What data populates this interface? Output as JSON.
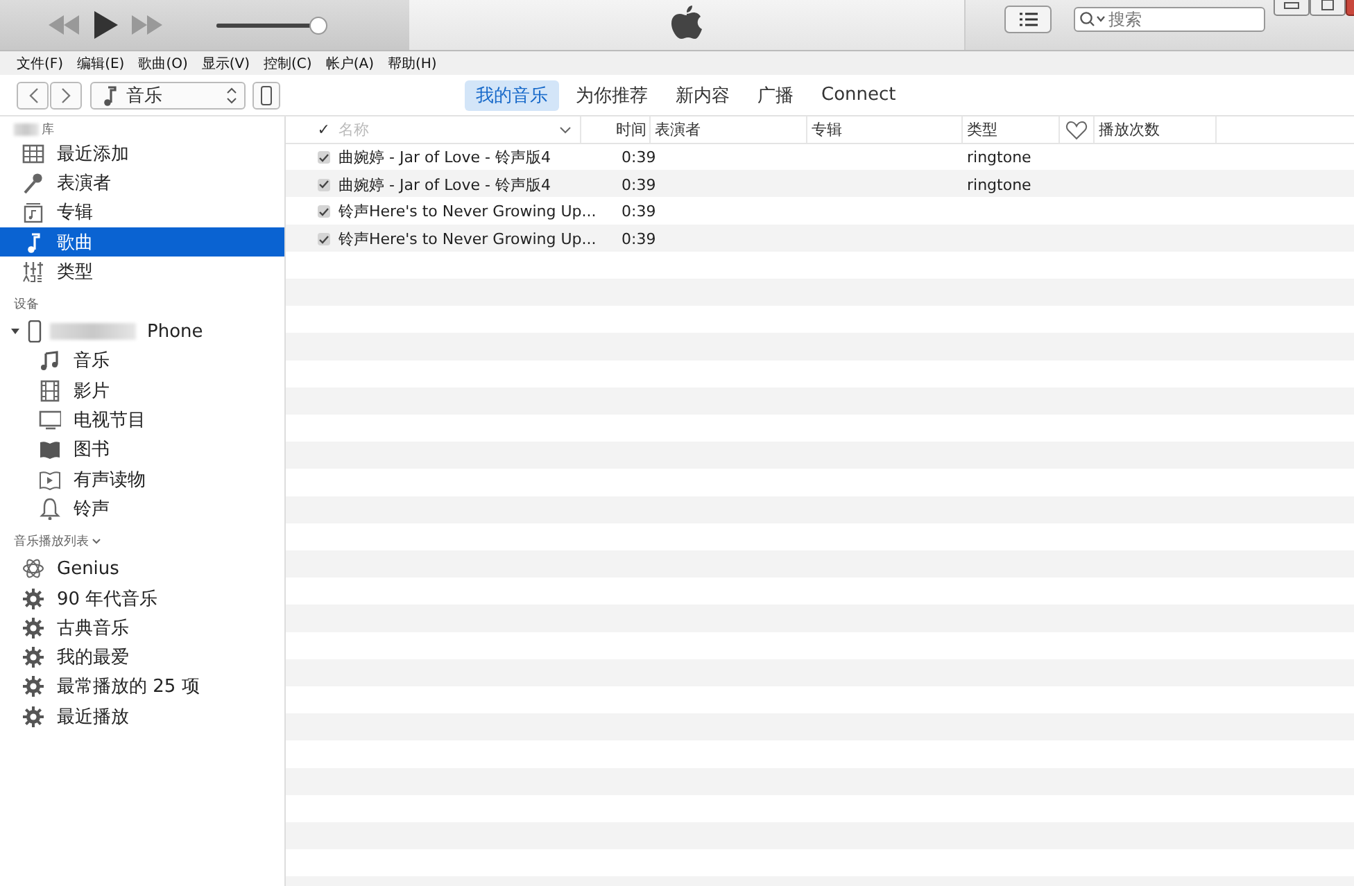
{
  "player": {
    "volume": {
      "level": 0.93
    }
  },
  "search": {
    "placeholder": "搜索"
  },
  "menu": [
    "文件(F)",
    "编辑(E)",
    "歌曲(O)",
    "显示(V)",
    "控制(C)",
    "帐户(A)",
    "帮助(H)"
  ],
  "media_picker": {
    "value": "音乐"
  },
  "tabs": [
    {
      "label": "我的音乐",
      "selected": true
    },
    {
      "label": "为你推荐",
      "selected": false
    },
    {
      "label": "新内容",
      "selected": false
    },
    {
      "label": "广播",
      "selected": false
    },
    {
      "label": "Connect",
      "selected": false
    }
  ],
  "sidebar": {
    "library": {
      "header": "库",
      "items": [
        {
          "label": "最近添加",
          "selected": false
        },
        {
          "label": "表演者",
          "selected": false
        },
        {
          "label": "专辑",
          "selected": false
        },
        {
          "label": "歌曲",
          "selected": true
        },
        {
          "label": "类型",
          "selected": false
        }
      ]
    },
    "devices": {
      "header": "设备",
      "device": {
        "label": "Phone",
        "expanded": true,
        "children": [
          {
            "label": "音乐"
          },
          {
            "label": "影片"
          },
          {
            "label": "电视节目"
          },
          {
            "label": "图书"
          },
          {
            "label": "有声读物"
          },
          {
            "label": "铃声"
          }
        ]
      }
    },
    "playlists": {
      "header": "音乐播放列表",
      "items": [
        {
          "label": "Genius"
        },
        {
          "label": "90 年代音乐"
        },
        {
          "label": "古典音乐"
        },
        {
          "label": "我的最爱"
        },
        {
          "label": "最常播放的 25 项"
        },
        {
          "label": "最近播放"
        }
      ]
    }
  },
  "table": {
    "columns": [
      "✓",
      "名称",
      "时间",
      "表演者",
      "专辑",
      "类型",
      "播放次数"
    ],
    "rows": [
      {
        "checked": true,
        "name": "曲婉婷 - Jar of Love - 铃声版4",
        "time": "0:39",
        "genre": "ringtone"
      },
      {
        "checked": true,
        "name": "曲婉婷 - Jar of Love - 铃声版4",
        "time": "0:39",
        "genre": "ringtone"
      },
      {
        "checked": true,
        "name": "铃声Here's to Never Growing Up...",
        "time": "0:39"
      },
      {
        "checked": true,
        "name": "铃声Here's to Never Growing Up...",
        "time": "0:39"
      }
    ]
  }
}
